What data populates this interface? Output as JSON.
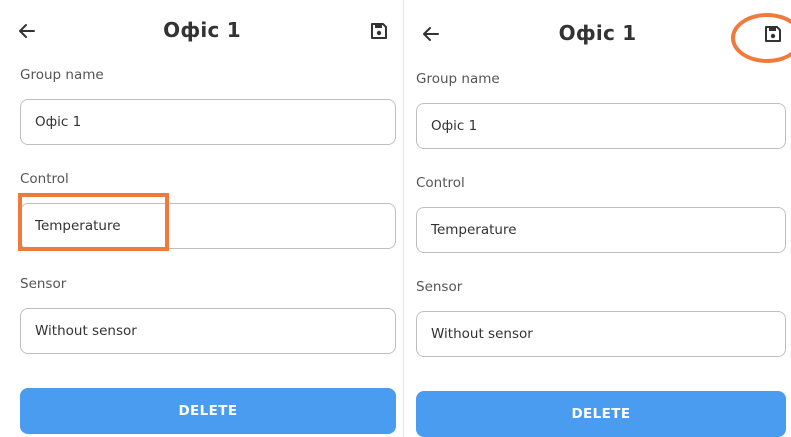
{
  "screens": [
    {
      "title": "Офіс 1",
      "group_name_label": "Group name",
      "group_name_value": "Офіс 1",
      "control_label": "Control",
      "control_value": "Temperature",
      "sensor_label": "Sensor",
      "sensor_value": "Without sensor",
      "delete_label": "DELETE",
      "back_icon": "arrow-left-icon",
      "save_icon": "floppy-disk-icon"
    },
    {
      "title": "Офіс 1",
      "group_name_label": "Group name",
      "group_name_value": "Офіс 1",
      "control_label": "Control",
      "control_value": "Temperature",
      "sensor_label": "Sensor",
      "sensor_value": "Without sensor",
      "delete_label": "DELETE",
      "back_icon": "arrow-left-icon",
      "save_icon": "floppy-disk-icon"
    }
  ],
  "colors": {
    "accent": "#4a9cf0",
    "annotation": "#f07a3c",
    "text": "#333333",
    "label": "#555555",
    "border": "#bfbfbf"
  },
  "annotations": [
    {
      "type": "rectangle",
      "target": "control-field"
    },
    {
      "type": "ellipse",
      "target": "save-button"
    }
  ]
}
